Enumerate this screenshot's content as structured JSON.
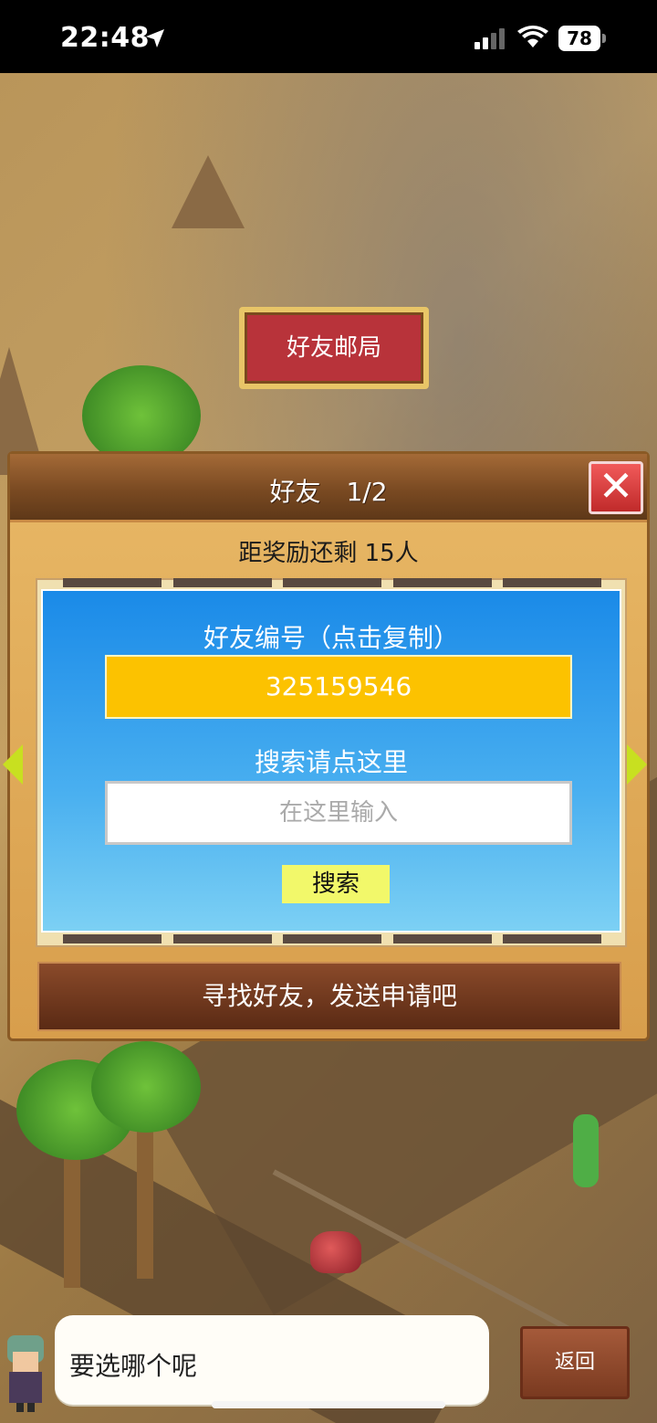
{
  "status_bar": {
    "time": "22:48",
    "battery": "78"
  },
  "map": {
    "sign_label": "好友邮局"
  },
  "dialog": {
    "title": "好友　1/2",
    "close_label": "✕",
    "reward_text": "距奖励还剩 15人",
    "friend_code_label": "好友编号（点击复制）",
    "friend_code": "325159546",
    "search_label": "搜索请点这里",
    "search_placeholder": "在这里输入",
    "search_button": "搜索",
    "find_friends_button": "寻找好友，发送申请吧"
  },
  "bottom": {
    "speech_text": "要选哪个呢",
    "back_button": "返回"
  },
  "colors": {
    "panel_blue": "#1a8ae8",
    "code_box": "#fcc200",
    "close_red": "#e04040",
    "header_brown": "#7a4a22"
  }
}
